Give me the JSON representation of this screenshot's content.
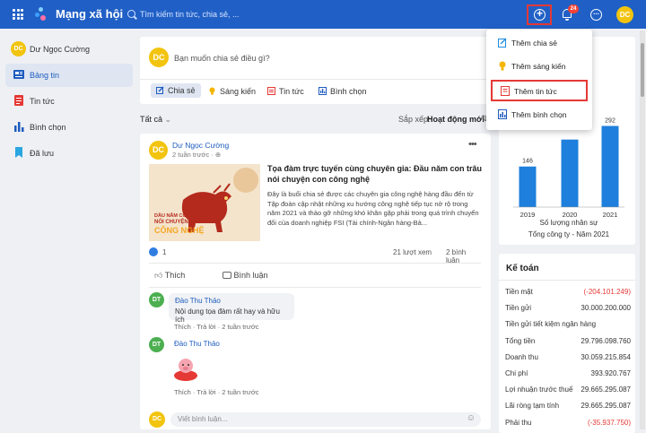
{
  "app": {
    "title": "Mạng xã hội",
    "search_placeholder": "Tìm kiếm tin tức, chia sẻ, ...",
    "notification_count": "24",
    "user_initials": "DC"
  },
  "sidebar": {
    "user_name": "Dư Ngọc Cường",
    "items": [
      {
        "label": "Bảng tin",
        "icon": "newsfeed-icon",
        "active": true
      },
      {
        "label": "Tin tức",
        "icon": "news-icon"
      },
      {
        "label": "Bình chọn",
        "icon": "poll-icon"
      },
      {
        "label": "Đã lưu",
        "icon": "bookmark-icon"
      }
    ]
  },
  "composer": {
    "placeholder": "Bạn muốn chia sẻ điều gì?",
    "actions": [
      "Chia sẻ",
      "Sáng kiến",
      "Tin tức",
      "Bình chọn"
    ]
  },
  "feed": {
    "filter_label": "Tất cả",
    "sort_label": "Sắp xếp:",
    "sort_value": "Hoạt động mới"
  },
  "post": {
    "author": "Dư Ngọc Cường",
    "author_initials": "DC",
    "time": "2 tuần trước",
    "title": "Tọa đàm trực tuyến cùng chuyên gia: Đầu năm con trâu nói chuyện con công nghệ",
    "excerpt": "Đây là buổi chia sẻ được các chuyên gia công nghệ hàng đầu đến từ Tập đoàn cập nhật những xu hướng công nghệ tiếp tục nở rộ trong năm 2021 và thảo gỡ những khó khăn gặp phải trong quá trình chuyển đổi của doanh nghiệp FSI (Tài chính-Ngân hàng-Bả...",
    "thumb_text": [
      "DẦU NĂM CON TRÂU",
      "NÓI CHUYỆN CON",
      "CÔNG NGHỆ"
    ],
    "like_count": "1",
    "views": "21 lượt xem",
    "comments": "2 bình luận",
    "like_label": "Thích",
    "comment_label": "Bình luận"
  },
  "comments": [
    {
      "initials": "DT",
      "name": "Đào Thu Thảo",
      "text": "Nội dung tọa đàm rất hay và hữu ích",
      "like": "Thích",
      "reply": "Trả lời",
      "time": "2 tuần trước"
    },
    {
      "initials": "DT",
      "name": "Đào Thu Thảo",
      "text": "",
      "like": "Thích",
      "reply": "Trả lời",
      "time": "2 tuần trước"
    }
  ],
  "write_comment": {
    "placeholder": "Viết bình luận...",
    "initials": "DC"
  },
  "dropdown": {
    "items": [
      {
        "label": "Thêm chia sẻ",
        "icon": "share-edit-icon"
      },
      {
        "label": "Thêm sáng kiến",
        "icon": "lightbulb-icon"
      },
      {
        "label": "Thêm tin tức",
        "icon": "news-add-icon",
        "highlighted": true
      },
      {
        "label": "Thêm bình chọn",
        "icon": "poll-add-icon"
      }
    ]
  },
  "chart_data": {
    "type": "bar",
    "categories": [
      "2019",
      "2020",
      "2021"
    ],
    "values": [
      146,
      null,
      292
    ],
    "value_labels": [
      "146",
      "",
      "292"
    ],
    "xlabel": "Số lượng nhân sự",
    "subtitle": "Tổng công ty - Năm 2021",
    "color": "#1e7fdc"
  },
  "finance": {
    "title": "Kế toán",
    "rows": [
      {
        "label": "Tiền mặt",
        "value": "(-204.101.249)",
        "negative": true
      },
      {
        "label": "Tiền gửi",
        "value": "30.000.200.000"
      },
      {
        "label": "Tiền gửi tiết kiệm ngân hàng",
        "value": ""
      },
      {
        "label": "Tổng tiền",
        "value": "29.796.098.760"
      },
      {
        "label": "Doanh thu",
        "value": "30.059.215.854"
      },
      {
        "label": "Chi phí",
        "value": "393.920.767"
      },
      {
        "label": "Lợi nhuận trước thuế",
        "value": "29.665.295.087"
      },
      {
        "label": "Lãi ròng tạm tính",
        "value": "29.665.295.087"
      },
      {
        "label": "Phải thu",
        "value": "(-35.937.750)",
        "negative": true
      }
    ]
  }
}
